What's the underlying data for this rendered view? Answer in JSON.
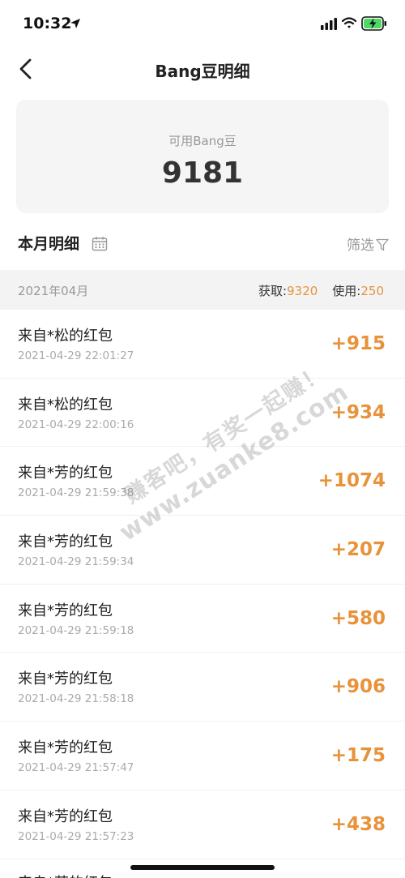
{
  "status_bar": {
    "time": "10:32"
  },
  "nav": {
    "title": "Bang豆明细"
  },
  "balance": {
    "label": "可用Bang豆",
    "value": "9181"
  },
  "section": {
    "title": "本月明细",
    "filter_label": "筛选"
  },
  "month_bar": {
    "month": "2021年04月",
    "earned_label": "获取:",
    "earned_value": "9320",
    "used_label": "使用:",
    "used_value": "250"
  },
  "transactions": [
    {
      "title": "来自*松的红包",
      "time": "2021-04-29 22:01:27",
      "amount": "+915"
    },
    {
      "title": "来自*松的红包",
      "time": "2021-04-29 22:00:16",
      "amount": "+934"
    },
    {
      "title": "来自*芳的红包",
      "time": "2021-04-29 21:59:38",
      "amount": "+1074"
    },
    {
      "title": "来自*芳的红包",
      "time": "2021-04-29 21:59:34",
      "amount": "+207"
    },
    {
      "title": "来自*芳的红包",
      "time": "2021-04-29 21:59:18",
      "amount": "+580"
    },
    {
      "title": "来自*芳的红包",
      "time": "2021-04-29 21:58:18",
      "amount": "+906"
    },
    {
      "title": "来自*芳的红包",
      "time": "2021-04-29 21:57:47",
      "amount": "+175"
    },
    {
      "title": "来自*芳的红包",
      "time": "2021-04-29 21:57:23",
      "amount": "+438"
    }
  ],
  "partial_row": {
    "title": "来自*芳的红包"
  },
  "watermark": {
    "line1": "赚客吧，有奖一起赚！",
    "line2": "www.zuanke8.com"
  },
  "colors": {
    "accent": "#e8923a",
    "card_bg": "#f5f5f5",
    "month_bar_bg": "#f3f3f3"
  },
  "icons": [
    "location-arrow-icon",
    "signal-icon",
    "wifi-icon",
    "battery-charging-icon",
    "back-arrow-icon",
    "calendar-icon",
    "filter-funnel-icon"
  ]
}
